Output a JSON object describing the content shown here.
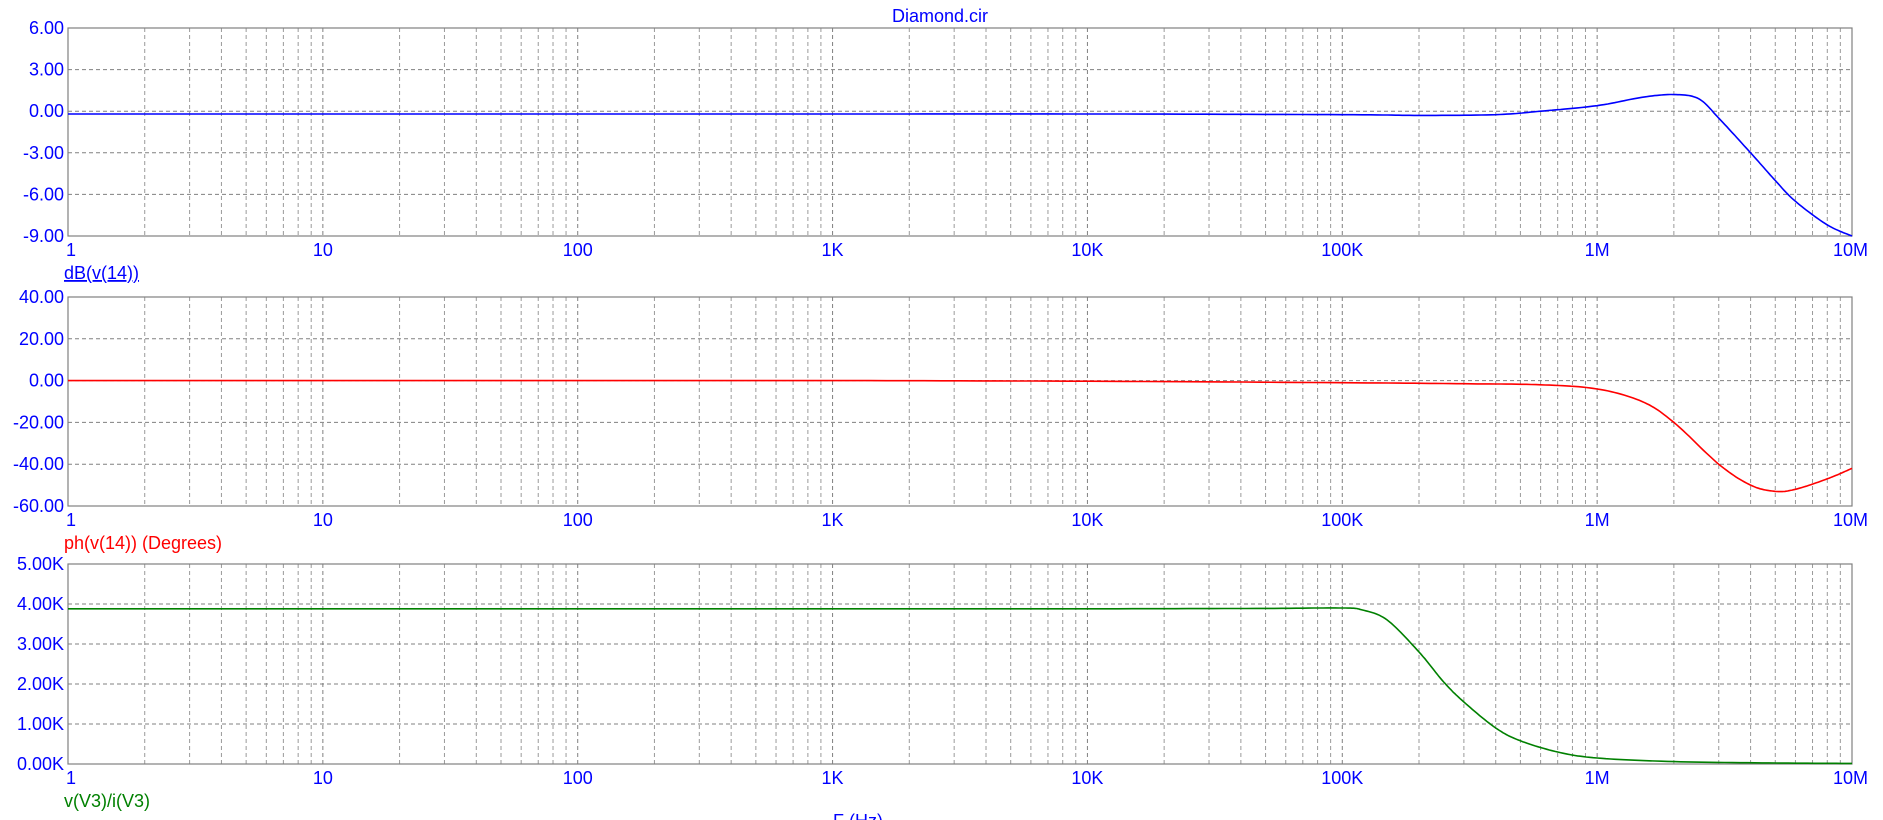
{
  "window": {
    "title": "Diamond.cir"
  },
  "x_axis": {
    "label": "F (Hz)",
    "tick_labels": [
      "1",
      "10",
      "100",
      "1K",
      "10K",
      "100K",
      "1M",
      "10M"
    ]
  },
  "chart_data": [
    {
      "type": "line",
      "title": "Diamond.cir",
      "xlabel": "F (Hz)",
      "ylabel": "",
      "xscale": "log",
      "xlim": [
        1,
        10000000
      ],
      "ylim": [
        -9,
        6
      ],
      "grid": true,
      "trace_label": "dB(v(14))",
      "trace_label_underlined": true,
      "y_tick_labels": [
        "6.00",
        "3.00",
        "0.00",
        "-3.00",
        "-6.00",
        "-9.00"
      ],
      "series": [
        {
          "name": "dB(v(14))",
          "color": "#0000ff",
          "x": [
            1,
            10,
            100,
            1000,
            10000,
            100000,
            200000,
            400000,
            600000,
            1000000,
            1500000,
            2000000,
            2500000,
            3000000,
            4000000,
            5000000,
            6000000,
            8000000,
            10000000
          ],
          "y": [
            -0.2,
            -0.2,
            -0.2,
            -0.2,
            -0.2,
            -0.25,
            -0.3,
            -0.25,
            0.0,
            0.4,
            1.0,
            1.2,
            0.9,
            -0.5,
            -3.0,
            -5.0,
            -6.5,
            -8.2,
            -9.0
          ]
        }
      ]
    },
    {
      "type": "line",
      "title": "",
      "xlabel": "F (Hz)",
      "ylabel": "",
      "xscale": "log",
      "xlim": [
        1,
        10000000
      ],
      "ylim": [
        -60,
        40
      ],
      "grid": true,
      "trace_label": "ph(v(14)) (Degrees)",
      "trace_label_underlined": false,
      "y_tick_labels": [
        "40.00",
        "20.00",
        "0.00",
        "-20.00",
        "-40.00",
        "-60.00"
      ],
      "series": [
        {
          "name": "ph(v(14)) (Degrees)",
          "color": "#ff0000",
          "x": [
            1,
            10,
            100,
            1000,
            10000,
            100000,
            300000,
            600000,
            1000000,
            1500000,
            2000000,
            3000000,
            4000000,
            5000000,
            6000000,
            8000000,
            10000000
          ],
          "y": [
            0,
            0,
            0,
            0,
            -0.3,
            -1,
            -1.5,
            -2,
            -4,
            -10,
            -20,
            -40,
            -50,
            -53,
            -52,
            -47,
            -42
          ]
        }
      ]
    },
    {
      "type": "line",
      "title": "",
      "xlabel": "F (Hz)",
      "ylabel": "",
      "xscale": "log",
      "xlim": [
        1,
        10000000
      ],
      "ylim": [
        0,
        5000
      ],
      "grid": true,
      "trace_label": "v(V3)/i(V3)",
      "trace_label_underlined": false,
      "y_tick_labels": [
        "5.00K",
        "4.00K",
        "3.00K",
        "2.00K",
        "1.00K",
        "0.00K"
      ],
      "series": [
        {
          "name": "v(V3)/i(V3)",
          "color": "#008000",
          "x": [
            1,
            10,
            100,
            1000,
            10000,
            50000,
            100000,
            120000,
            150000,
            200000,
            250000,
            300000,
            400000,
            500000,
            700000,
            1000000,
            2000000,
            5000000,
            10000000
          ],
          "y": [
            3880,
            3880,
            3880,
            3880,
            3880,
            3890,
            3900,
            3850,
            3600,
            2800,
            2050,
            1550,
            900,
            580,
            300,
            150,
            60,
            25,
            15
          ]
        }
      ]
    }
  ]
}
